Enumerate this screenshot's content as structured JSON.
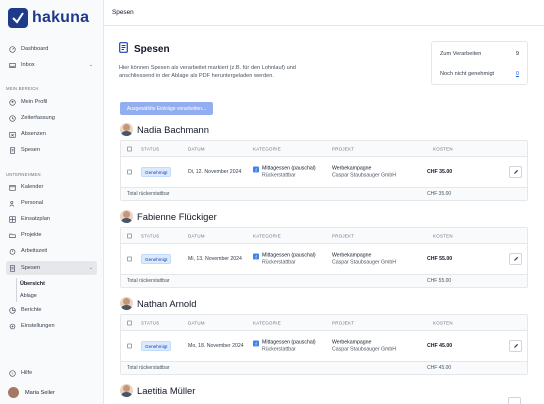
{
  "app": {
    "logo_text": "hakuna"
  },
  "sidebar": {
    "items_top": [
      {
        "label": "Dashboard",
        "icon": "dashboard-icon"
      },
      {
        "label": "Inbox",
        "icon": "inbox-icon"
      }
    ],
    "section_my": "MEIN BEREICH",
    "items_my": [
      {
        "label": "Mein Profil",
        "icon": "user-circle-icon"
      },
      {
        "label": "Zeiterfassung",
        "icon": "clock-icon"
      },
      {
        "label": "Absenzen",
        "icon": "calendar-x-icon"
      },
      {
        "label": "Spesen",
        "icon": "receipt-icon"
      }
    ],
    "section_company": "UNTERNEHMEN",
    "items_company": [
      {
        "label": "Kalender",
        "icon": "calendar-icon"
      },
      {
        "label": "Personal",
        "icon": "users-icon"
      },
      {
        "label": "Einsatzplan",
        "icon": "schedule-icon"
      },
      {
        "label": "Projekte",
        "icon": "folder-icon"
      },
      {
        "label": "Arbeitszeit",
        "icon": "timer-icon"
      },
      {
        "label": "Spesen",
        "icon": "receipt-icon"
      }
    ],
    "sub_items": [
      "Übersicht",
      "Ablage"
    ],
    "items_bottom": [
      {
        "label": "Berichte",
        "icon": "chart-icon"
      },
      {
        "label": "Einstellungen",
        "icon": "gear-icon"
      }
    ],
    "help": "Hilfe",
    "user_name": "Maria Seiler"
  },
  "topbar": {
    "title": "Spesen"
  },
  "page": {
    "title": "Spesen",
    "description": "Hier können Spesen als verarbeitet markiert (z.B. für den Lohnlauf) und anschliessend in der Ablage als PDF heruntergeladen werden.",
    "bulk_button": "Ausgewählte Einträge verarbeiten..."
  },
  "stats": {
    "to_process_label": "Zum Verarbeiten",
    "to_process_value": "9",
    "not_approved_label": "Noch nicht genehmigt",
    "not_approved_value": "0"
  },
  "table_headers": {
    "status": "STATUS",
    "date": "DATUM",
    "category": "KATEGORIE",
    "project": "PROJEKT",
    "cost": "KOSTEN"
  },
  "total_label": "Total rückerstattbar",
  "persons": [
    {
      "name": "Nadia Bachmann",
      "row": {
        "status": "Genehmigt",
        "date": "Di, 12. November 2024",
        "category": "Mittagessen (pauschal)",
        "category_sub": "Rückerstattbar",
        "project": "Werbekampagne",
        "project_sub": "Caspar Staubsauger GmbH",
        "amount": "CHF 35.00"
      },
      "total": "CHF 35.00"
    },
    {
      "name": "Fabienne Flückiger",
      "row": {
        "status": "Genehmigt",
        "date": "Mi, 13. November 2024",
        "category": "Mittagessen (pauschal)",
        "category_sub": "Rückerstattbar",
        "project": "Werbekampagne",
        "project_sub": "Caspar Staubsauger GmbH",
        "amount": "CHF 55.00"
      },
      "total": "CHF 55.00"
    },
    {
      "name": "Nathan Arnold",
      "row": {
        "status": "Genehmigt",
        "date": "Mo, 18. November 2024",
        "category": "Mittagessen (pauschal)",
        "category_sub": "Rückerstattbar",
        "project": "Werbekampagne",
        "project_sub": "Caspar Staubsauger GmbH",
        "amount": "CHF 45.00"
      },
      "total": "CHF 45.00"
    },
    {
      "name": "Laetitia Müller"
    }
  ]
}
